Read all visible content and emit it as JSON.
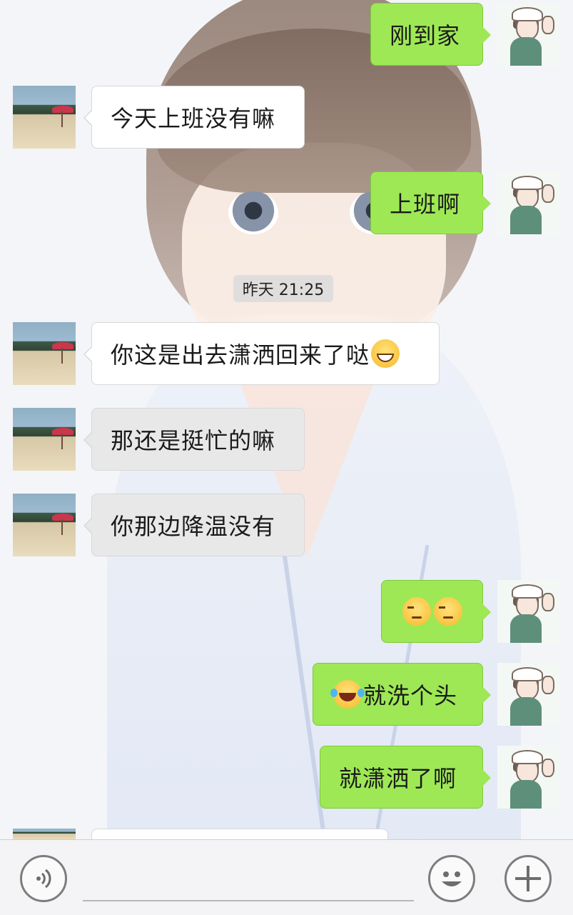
{
  "timestamp": "昨天 21:25",
  "messages": [
    {
      "side": "right",
      "text": "刚到家"
    },
    {
      "side": "left",
      "text": "今天上班没有嘛"
    },
    {
      "side": "right",
      "text": "上班啊"
    },
    {
      "side": "left",
      "text": "你这是出去潇洒回来了哒",
      "emoji_after": "grin-icon"
    },
    {
      "side": "left",
      "text": "那还是挺忙的嘛"
    },
    {
      "side": "left",
      "text": "你那边降温没有"
    },
    {
      "side": "right",
      "text": "",
      "emojis": [
        "unamused-icon",
        "unamused-icon"
      ]
    },
    {
      "side": "right",
      "text": "就洗个头",
      "emoji_before": "joy-icon"
    },
    {
      "side": "right",
      "text": "就潇洒了啊"
    }
  ],
  "colors": {
    "outgoing_bubble": "#9ee855",
    "incoming_bubble": "#ffffff",
    "incoming_bubble_pressed": "#e8e8e8",
    "input_bar": "#f4f4f6"
  },
  "input_bar": {
    "voice_icon": "voice-icon",
    "emoji_icon": "emoji-icon",
    "plus_icon": "plus-icon"
  }
}
